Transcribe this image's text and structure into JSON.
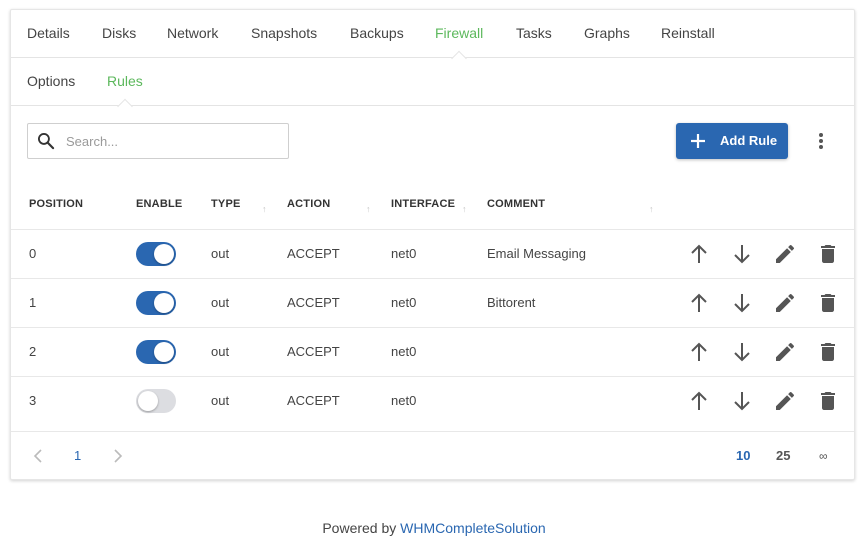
{
  "tabs": [
    {
      "label": "Details"
    },
    {
      "label": "Disks"
    },
    {
      "label": "Network"
    },
    {
      "label": "Snapshots"
    },
    {
      "label": "Backups"
    },
    {
      "label": "Firewall"
    },
    {
      "label": "Tasks"
    },
    {
      "label": "Graphs"
    },
    {
      "label": "Reinstall"
    }
  ],
  "active_tab": "Firewall",
  "subtabs": [
    {
      "label": "Options"
    },
    {
      "label": "Rules"
    }
  ],
  "active_subtab": "Rules",
  "search": {
    "placeholder": "Search...",
    "value": ""
  },
  "toolbar": {
    "add_rule_label": "Add Rule"
  },
  "table": {
    "headers": {
      "position": "POSITION",
      "enable": "ENABLE",
      "type": "TYPE",
      "action": "ACTION",
      "interface": "INTERFACE",
      "comment": "COMMENT"
    },
    "rows": [
      {
        "position": "0",
        "enabled": true,
        "type": "out",
        "action": "ACCEPT",
        "interface": "net0",
        "comment": "Email Messaging"
      },
      {
        "position": "1",
        "enabled": true,
        "type": "out",
        "action": "ACCEPT",
        "interface": "net0",
        "comment": "Bittorent"
      },
      {
        "position": "2",
        "enabled": true,
        "type": "out",
        "action": "ACCEPT",
        "interface": "net0",
        "comment": ""
      },
      {
        "position": "3",
        "enabled": false,
        "type": "out",
        "action": "ACCEPT",
        "interface": "net0",
        "comment": ""
      }
    ],
    "row_actions": [
      "arrow-up-icon",
      "arrow-down-icon",
      "pencil-icon",
      "trash-icon"
    ]
  },
  "pagination": {
    "current_page": "1",
    "per_page_options": [
      "10",
      "25",
      "∞"
    ],
    "selected_per_page": "10"
  },
  "footer": {
    "prefix": "Powered by",
    "link": "WHMCompleteSolution"
  },
  "colors": {
    "accent_green": "#5cb85c",
    "primary_blue": "#2a67b1",
    "toggle_off": "#dcdde1"
  }
}
